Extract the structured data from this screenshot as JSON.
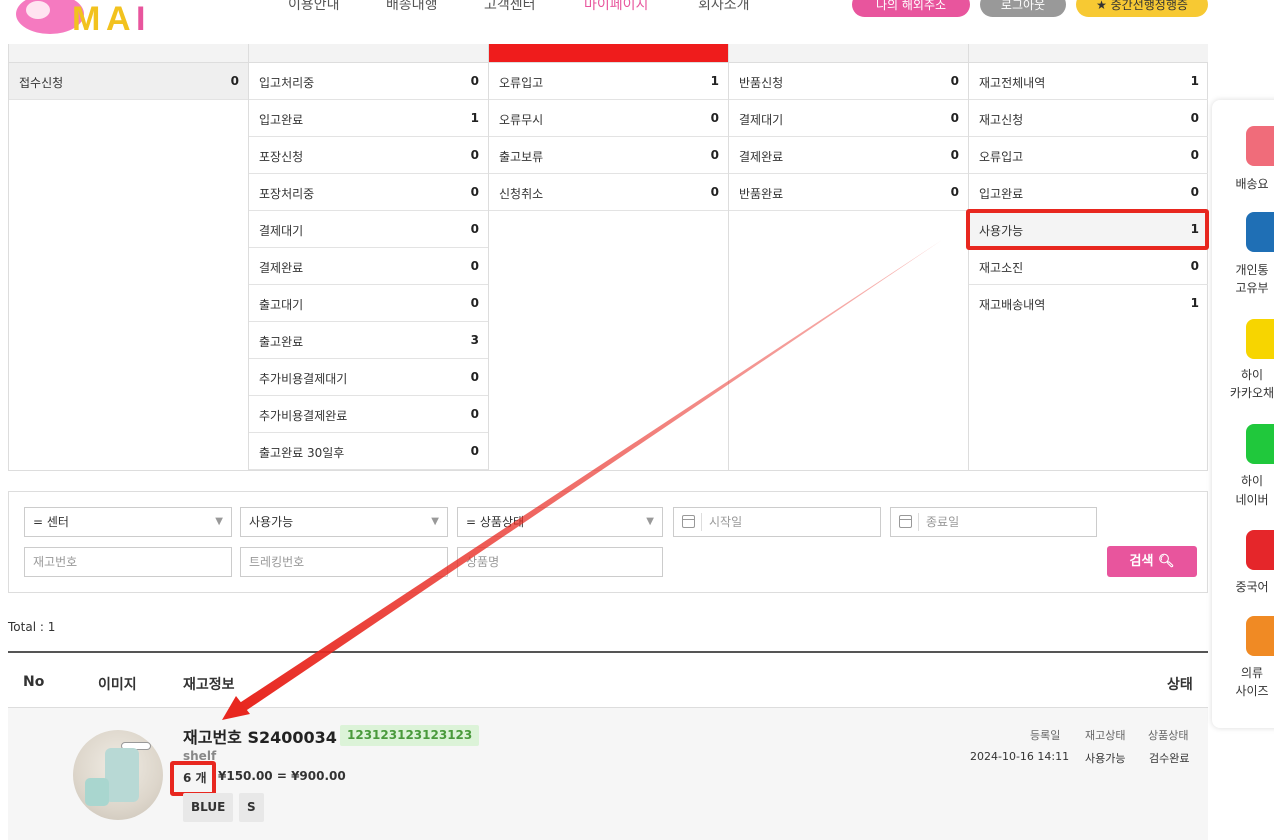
{
  "header": {
    "nav": [
      {
        "label": "이용안내",
        "active": false
      },
      {
        "label": "배송대행",
        "active": false
      },
      {
        "label": "고객센터",
        "active": false
      },
      {
        "label": "마이페이지",
        "active": true
      },
      {
        "label": "회사소개",
        "active": false
      }
    ],
    "buttons": {
      "address": "나의 해외주소",
      "logout": "로그아웃",
      "grade": "★ 중간선행정행증"
    }
  },
  "status_columns": [
    {
      "rows": [
        {
          "label": "접수신청",
          "count": "0"
        }
      ]
    },
    {
      "rows": [
        {
          "label": "입고처리중",
          "count": "0"
        },
        {
          "label": "입고완료",
          "count": "1"
        },
        {
          "label": "포장신청",
          "count": "0"
        },
        {
          "label": "포장처리중",
          "count": "0"
        },
        {
          "label": "결제대기",
          "count": "0"
        },
        {
          "label": "결제완료",
          "count": "0"
        },
        {
          "label": "출고대기",
          "count": "0"
        },
        {
          "label": "출고완료",
          "count": "3"
        },
        {
          "label": "추가비용결제대기",
          "count": "0"
        },
        {
          "label": "추가비용결제완료",
          "count": "0"
        },
        {
          "label": "출고완료 30일후",
          "count": "0"
        }
      ]
    },
    {
      "rows": [
        {
          "label": "오류입고",
          "count": "1"
        },
        {
          "label": "오류무시",
          "count": "0"
        },
        {
          "label": "출고보류",
          "count": "0"
        },
        {
          "label": "신청취소",
          "count": "0"
        }
      ]
    },
    {
      "rows": [
        {
          "label": "반품신청",
          "count": "0"
        },
        {
          "label": "결제대기",
          "count": "0"
        },
        {
          "label": "결제완료",
          "count": "0"
        },
        {
          "label": "반품완료",
          "count": "0"
        }
      ]
    },
    {
      "rows": [
        {
          "label": "재고전체내역",
          "count": "1"
        },
        {
          "label": "재고신청",
          "count": "0"
        },
        {
          "label": "오류입고",
          "count": "0"
        },
        {
          "label": "입고완료",
          "count": "0"
        },
        {
          "label": "사용가능",
          "count": "1"
        },
        {
          "label": "재고소진",
          "count": "0"
        },
        {
          "label": "재고배송내역",
          "count": "1"
        }
      ]
    }
  ],
  "search": {
    "center": "= 센터",
    "status": "사용가능",
    "product_status": "= 상품상태",
    "start_date": "시작일",
    "end_date": "종료일",
    "inventory_no": "재고번호",
    "tracking_no": "트레킹번호",
    "product_name": "상품명",
    "button": "검색"
  },
  "total": "Total : 1",
  "table": {
    "headers": {
      "no": "No",
      "image": "이미지",
      "info": "재고정보",
      "status": "상태"
    },
    "row": {
      "title": "재고번호 S2400034",
      "tracking": "123123123123123",
      "location": "shelf",
      "qty": "6 개",
      "price": "¥150.00 = ¥900.00",
      "options": [
        "BLUE",
        "S"
      ],
      "meta_labels": [
        "등록일",
        "재고상태",
        "상품상태"
      ],
      "meta_values": [
        "2024-10-16 14:11",
        "사용가능",
        "검수완료"
      ],
      "image_tag": "shelf"
    }
  },
  "side_menu": [
    {
      "label": "배송요",
      "color": "#f06c7a",
      "icon": "tag-icon"
    },
    {
      "label": "개인통",
      "label2": "고유부",
      "color": "#1f6fb5",
      "icon": "id-icon"
    },
    {
      "label": "하이",
      "label2": "카카오채",
      "color": "#f7d500",
      "icon": "kakao-icon"
    },
    {
      "label": "하이",
      "label2": "네이버",
      "color": "#20c83c",
      "icon": "naver-icon"
    },
    {
      "label": "중국어",
      "color": "#e5262a",
      "icon": "china-flag-icon"
    },
    {
      "label": "의류",
      "label2": "사이즈",
      "color": "#f08a24",
      "icon": "shirt-icon"
    }
  ],
  "colors": {
    "accent": "#e8559d",
    "highlight": "#e8271f",
    "track_bg": "#dcf3d8"
  }
}
